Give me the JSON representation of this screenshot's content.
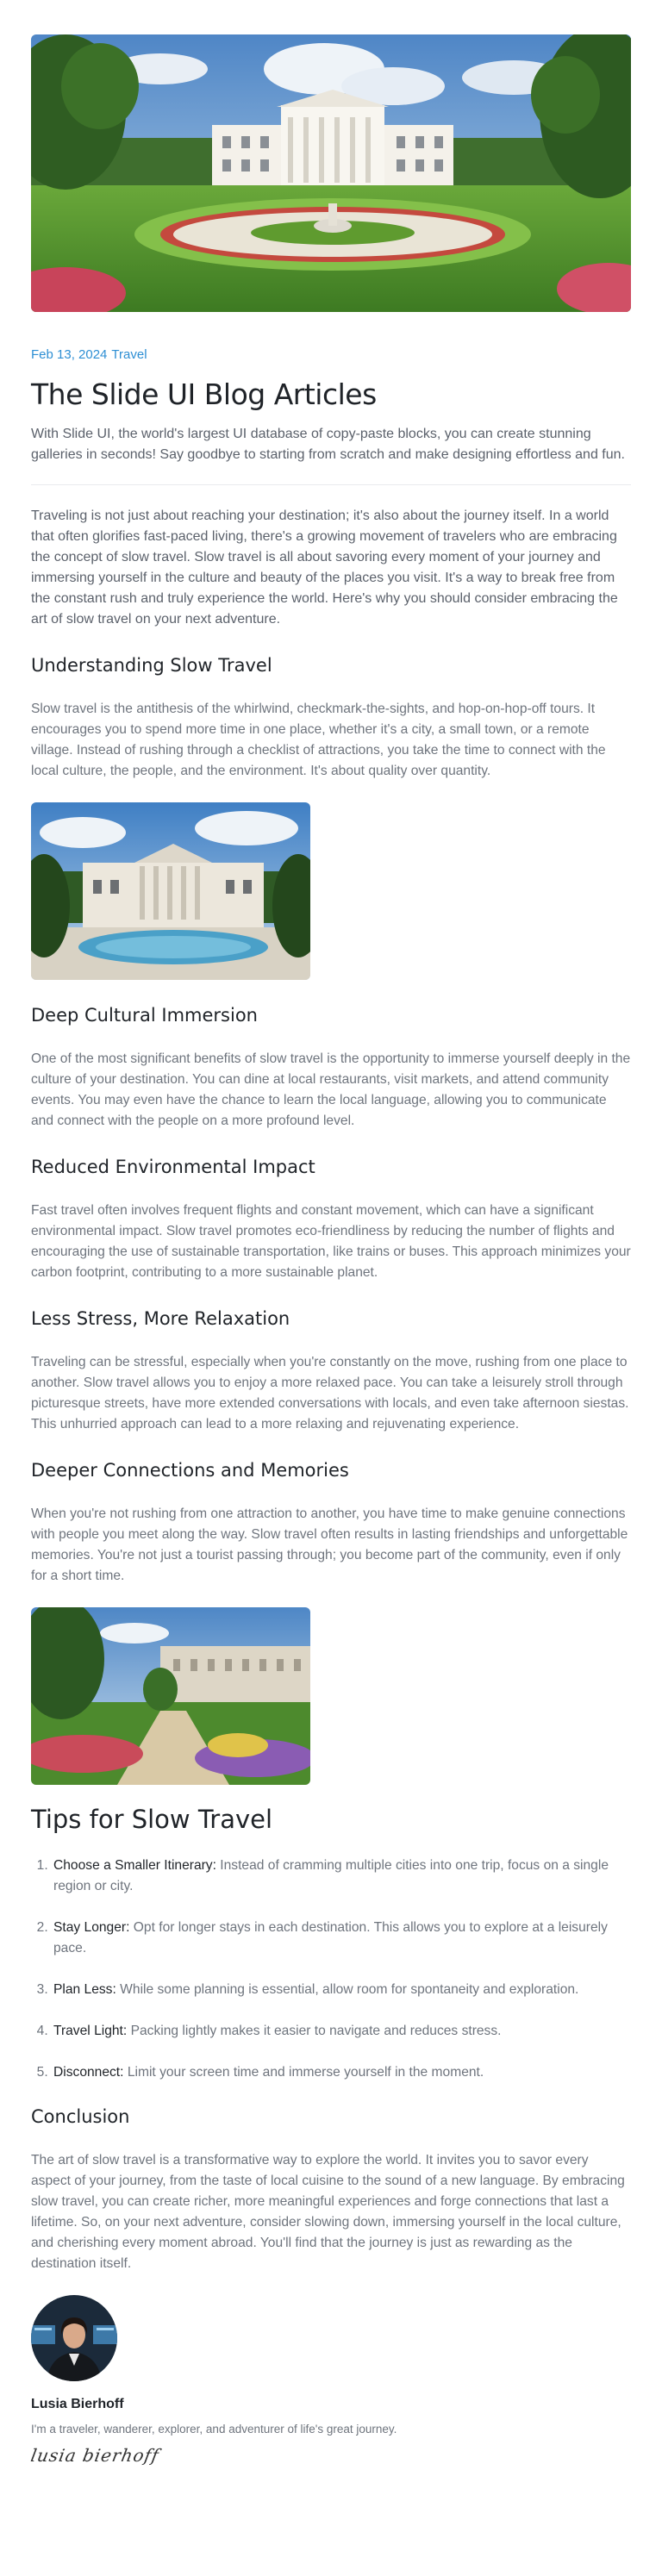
{
  "meta": {
    "date": "Feb 13, 2024",
    "category": "Travel"
  },
  "title": "The Slide UI Blog Articles",
  "lead": "With Slide UI, the world's largest UI database of copy-paste blocks, you can create stunning galleries in seconds! Say goodbye to starting from scratch and make designing effortless and fun.",
  "intro": "Traveling is not just about reaching your destination; it's also about the journey itself. In a world that often glorifies fast-paced living, there's a growing movement of travelers who are embracing the concept of slow travel. Slow travel is all about savoring every moment of your journey and immersing yourself in the culture and beauty of the places you visit. It's a way to break free from the constant rush and truly experience the world. Here's why you should consider embracing the art of slow travel on your next adventure.",
  "sections": [
    {
      "heading": "Understanding Slow Travel",
      "body": "Slow travel is the antithesis of the whirlwind, checkmark-the-sights, and hop-on-hop-off tours. It encourages you to spend more time in one place, whether it's a city, a small town, or a remote village. Instead of rushing through a checklist of attractions, you take the time to connect with the local culture, the people, and the environment. It's about quality over quantity."
    },
    {
      "heading": "Deep Cultural Immersion",
      "body": "One of the most significant benefits of slow travel is the opportunity to immerse yourself deeply in the culture of your destination. You can dine at local restaurants, visit markets, and attend community events. You may even have the chance to learn the local language, allowing you to communicate and connect with the people on a more profound level."
    },
    {
      "heading": "Reduced Environmental Impact",
      "body": "Fast travel often involves frequent flights and constant movement, which can have a significant environmental impact. Slow travel promotes eco-friendliness by reducing the number of flights and encouraging the use of sustainable transportation, like trains or buses. This approach minimizes your carbon footprint, contributing to a more sustainable planet."
    },
    {
      "heading": "Less Stress, More Relaxation",
      "body": "Traveling can be stressful, especially when you're constantly on the move, rushing from one place to another. Slow travel allows you to enjoy a more relaxed pace. You can take a leisurely stroll through picturesque streets, have more extended conversations with locals, and even take afternoon siestas. This unhurried approach can lead to a more relaxing and rejuvenating experience."
    },
    {
      "heading": "Deeper Connections and Memories",
      "body": "When you're not rushing from one attraction to another, you have time to make genuine connections with people you meet along the way. Slow travel often results in lasting friendships and unforgettable memories. You're not just a tourist passing through; you become part of the community, even if only for a short time."
    }
  ],
  "tips": {
    "heading": "Tips for Slow Travel",
    "items": [
      {
        "term": "Choose a Smaller Itinerary:",
        "text": "Instead of cramming multiple cities into one trip, focus on a single region or city."
      },
      {
        "term": "Stay Longer:",
        "text": "Opt for longer stays in each destination. This allows you to explore at a leisurely pace."
      },
      {
        "term": "Plan Less:",
        "text": "While some planning is essential, allow room for spontaneity and exploration."
      },
      {
        "term": "Travel Light:",
        "text": "Packing lightly makes it easier to navigate and reduces stress."
      },
      {
        "term": "Disconnect:",
        "text": "Limit your screen time and immerse yourself in the moment."
      }
    ]
  },
  "conclusion": {
    "heading": "Conclusion",
    "body": "The art of slow travel is a transformative way to explore the world. It invites you to savor every aspect of your journey, from the taste of local cuisine to the sound of a new language. By embracing slow travel, you can create richer, more meaningful experiences and forge connections that last a lifetime. So, on your next adventure, consider slowing down, immersing yourself in the local culture, and cherishing every moment abroad. You'll find that the journey is just as rewarding as the destination itself."
  },
  "author": {
    "name": "Lusia Bierhoff",
    "bio": "I'm a traveler, wanderer, explorer, and adventurer of life's great journey.",
    "signature": "lusia bierhoff"
  },
  "colors": {
    "accent": "#2e8fd4",
    "heading": "#1f2328",
    "body": "#6e747d"
  }
}
